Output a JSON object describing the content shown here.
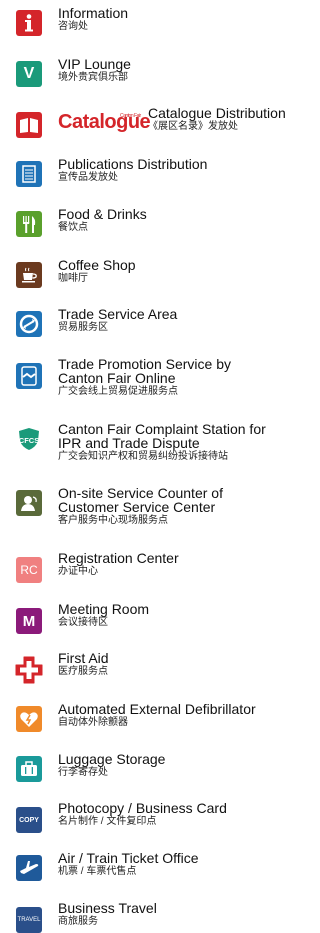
{
  "items": [
    {
      "icon": "info-icon",
      "color": "#d4252a",
      "en": "Information",
      "zh": "咨询处"
    },
    {
      "icon": "vip-icon",
      "color": "#1a9a7a",
      "en": "VIP Lounge",
      "zh": "境外贵宾俱乐部"
    },
    {
      "icon": "book-icon",
      "color": "#d4252a",
      "logo": "Catalogue",
      "logo_small": "Canton Fair",
      "en": "Catalogue Distribution",
      "zh": "《展区名录》发放处"
    },
    {
      "icon": "publication-icon",
      "color": "#1f73b7",
      "en": "Publications Distribution",
      "zh": "宣传品发放处"
    },
    {
      "icon": "food-icon",
      "color": "#5aa02c",
      "en": "Food & Drinks",
      "zh": "餐饮点"
    },
    {
      "icon": "coffee-icon",
      "color": "#6b3a1f",
      "en": "Coffee Shop",
      "zh": "咖啡厅"
    },
    {
      "icon": "trade-service-icon",
      "color": "#1f73b7",
      "en": "Trade Service Area",
      "zh": "贸易服务区"
    },
    {
      "icon": "handshake-icon",
      "color": "#1f73b7",
      "en": "Trade Promotion Service by\nCanton Fair Online",
      "zh": "广交会线上贸易促进服务点"
    },
    {
      "icon": "cfcs-shield-icon",
      "color": "#1a9a7a",
      "label": "CFCS",
      "en": "Canton Fair Complaint Station for\nIPR and Trade Dispute",
      "zh": "广交会知识产权和贸易纠纷投诉接待站"
    },
    {
      "icon": "customer-service-icon",
      "color": "#5a6a3a",
      "en": "On-site Service Counter of\nCustomer Service Center",
      "zh": "客户服务中心现场服务点"
    },
    {
      "icon": "registration-icon",
      "color": "#f08080",
      "label": "RC",
      "en": "Registration Center",
      "zh": "办证中心"
    },
    {
      "icon": "meeting-icon",
      "color": "#8b1a7a",
      "label": "M",
      "en": "Meeting Room",
      "zh": "会议接待区"
    },
    {
      "icon": "first-aid-icon",
      "color": "#d4252a",
      "en": "First Aid",
      "zh": "医疗服务点"
    },
    {
      "icon": "defibrillator-icon",
      "color": "#f08a2a",
      "en": "Automated External Defibrillator",
      "zh": "自动体外除颤器"
    },
    {
      "icon": "luggage-icon",
      "color": "#1a9a9a",
      "en": "Luggage Storage",
      "zh": "行李寄存处"
    },
    {
      "icon": "copy-icon",
      "color": "#2a4f8a",
      "label": "COPY",
      "en": "Photocopy / Business Card",
      "zh": "名片制作 / 文件复印点"
    },
    {
      "icon": "plane-icon",
      "color": "#1f5a9a",
      "en": "Air / Train Ticket Office",
      "zh": "机票 / 车票代售点"
    },
    {
      "icon": "travel-icon",
      "color": "#2a4f8a",
      "label": "TRAVEL",
      "en": "Business Travel",
      "zh": "商旅服务"
    }
  ]
}
